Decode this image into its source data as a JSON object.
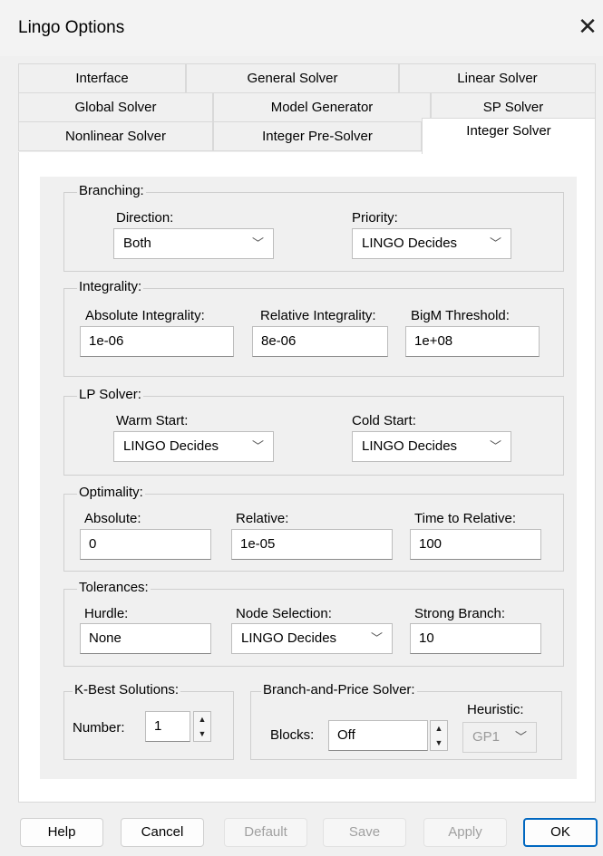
{
  "window": {
    "title": "Lingo Options",
    "close_icon": "close-icon"
  },
  "tabs": {
    "row1": [
      "Interface",
      "General Solver",
      "Linear Solver"
    ],
    "row2": [
      "Global Solver",
      "Model Generator",
      "SP Solver"
    ],
    "row3": [
      "Nonlinear Solver",
      "Integer Pre-Solver",
      "Integer Solver"
    ],
    "active": "Integer Solver"
  },
  "branching": {
    "title": "Branching:",
    "direction_label": "Direction:",
    "direction_value": "Both",
    "priority_label": "Priority:",
    "priority_value": "LINGO Decides"
  },
  "integrality": {
    "title": "Integrality:",
    "absolute_label": "Absolute Integrality:",
    "absolute_value": "1e-06",
    "relative_label": "Relative Integrality:",
    "relative_value": "8e-06",
    "bigm_label": "BigM Threshold:",
    "bigm_value": "1e+08"
  },
  "lp_solver": {
    "title": "LP Solver:",
    "warm_label": "Warm Start:",
    "warm_value": "LINGO Decides",
    "cold_label": "Cold Start:",
    "cold_value": "LINGO Decides"
  },
  "optimality": {
    "title": "Optimality:",
    "absolute_label": "Absolute:",
    "absolute_value": "0",
    "relative_label": "Relative:",
    "relative_value": "1e-05",
    "time_label": "Time to Relative:",
    "time_value": "100"
  },
  "tolerances": {
    "title": "Tolerances:",
    "hurdle_label": "Hurdle:",
    "hurdle_value": "None",
    "node_label": "Node Selection:",
    "node_value": "LINGO Decides",
    "strong_label": "Strong Branch:",
    "strong_value": "10"
  },
  "kbest": {
    "title": "K-Best Solutions:",
    "number_label": "Number:",
    "number_value": "1"
  },
  "bnp": {
    "title": "Branch-and-Price Solver:",
    "blocks_label": "Blocks:",
    "blocks_value": "Off",
    "heuristic_label": "Heuristic:",
    "heuristic_value": "GP1"
  },
  "buttons": {
    "help": "Help",
    "cancel": "Cancel",
    "default": "Default",
    "save": "Save",
    "apply": "Apply",
    "ok": "OK"
  }
}
